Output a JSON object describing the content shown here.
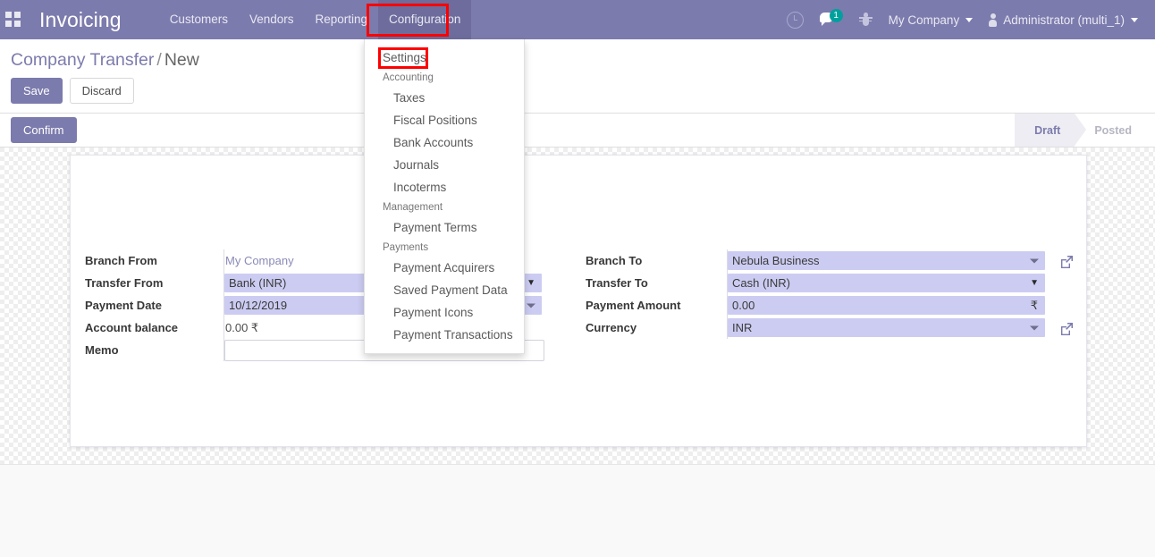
{
  "navbar": {
    "apps_icon": "apps-grid-icon",
    "brand": "Invoicing",
    "menus": [
      {
        "label": "Customers",
        "active": false
      },
      {
        "label": "Vendors",
        "active": false
      },
      {
        "label": "Reporting",
        "active": false
      },
      {
        "label": "Configuration",
        "active": true
      }
    ],
    "right": {
      "activities_icon": "clock-icon",
      "messages_icon": "chat-bubble-icon",
      "messages_count": "1",
      "debug_icon": "bug-icon",
      "company": "My Company",
      "user_icon": "user-avatar-icon",
      "user": "Administrator (multi_1)"
    }
  },
  "dropdown": {
    "items": [
      {
        "label": "Settings",
        "type": "item",
        "highlighted": true
      },
      {
        "label": "Accounting",
        "type": "header"
      },
      {
        "label": "Taxes",
        "type": "item-indent"
      },
      {
        "label": "Fiscal Positions",
        "type": "item-indent"
      },
      {
        "label": "Bank Accounts",
        "type": "item-indent"
      },
      {
        "label": "Journals",
        "type": "item-indent"
      },
      {
        "label": "Incoterms",
        "type": "item-indent"
      },
      {
        "label": "Management",
        "type": "header"
      },
      {
        "label": "Payment Terms",
        "type": "item-indent"
      },
      {
        "label": "Payments",
        "type": "header"
      },
      {
        "label": "Payment Acquirers",
        "type": "item-indent"
      },
      {
        "label": "Saved Payment Data",
        "type": "item-indent"
      },
      {
        "label": "Payment Icons",
        "type": "item-indent"
      },
      {
        "label": "Payment Transactions",
        "type": "item-indent"
      }
    ]
  },
  "control_panel": {
    "breadcrumb_root": "Company Transfer",
    "breadcrumb_sep": "/",
    "breadcrumb_leaf": "New",
    "save_label": "Save",
    "discard_label": "Discard",
    "confirm_label": "Confirm",
    "status": [
      {
        "label": "Draft",
        "state": "current"
      },
      {
        "label": "Posted",
        "state": "pending"
      }
    ]
  },
  "form": {
    "left": [
      {
        "label": "Branch From",
        "value": "My Company",
        "kind": "readonly-link"
      },
      {
        "label": "Transfer From",
        "value": "Bank (INR)",
        "kind": "select"
      },
      {
        "label": "Payment Date",
        "value": "10/12/2019",
        "kind": "date"
      },
      {
        "label": "Account balance",
        "value": "0.00 ₹",
        "kind": "readonly"
      },
      {
        "label": "Memo",
        "value": "",
        "kind": "text"
      }
    ],
    "right": [
      {
        "label": "Branch To",
        "value": "Nebula Business",
        "kind": "many2one",
        "ext_link": true
      },
      {
        "label": "Transfer To",
        "value": "Cash (INR)",
        "kind": "select",
        "ext_link": false
      },
      {
        "label": "Payment Amount",
        "value": "0.00",
        "kind": "monetary",
        "currency": "₹",
        "ext_link": false
      },
      {
        "label": "Currency",
        "value": "INR",
        "kind": "many2one",
        "ext_link": true
      }
    ]
  },
  "colors": {
    "navbar": "#7c7bad",
    "primary": "#7c7bad",
    "input_bg": "#ccccf2",
    "annotation": "#ff0000",
    "badge": "#00a09d",
    "status_active": "#7c7bad"
  }
}
